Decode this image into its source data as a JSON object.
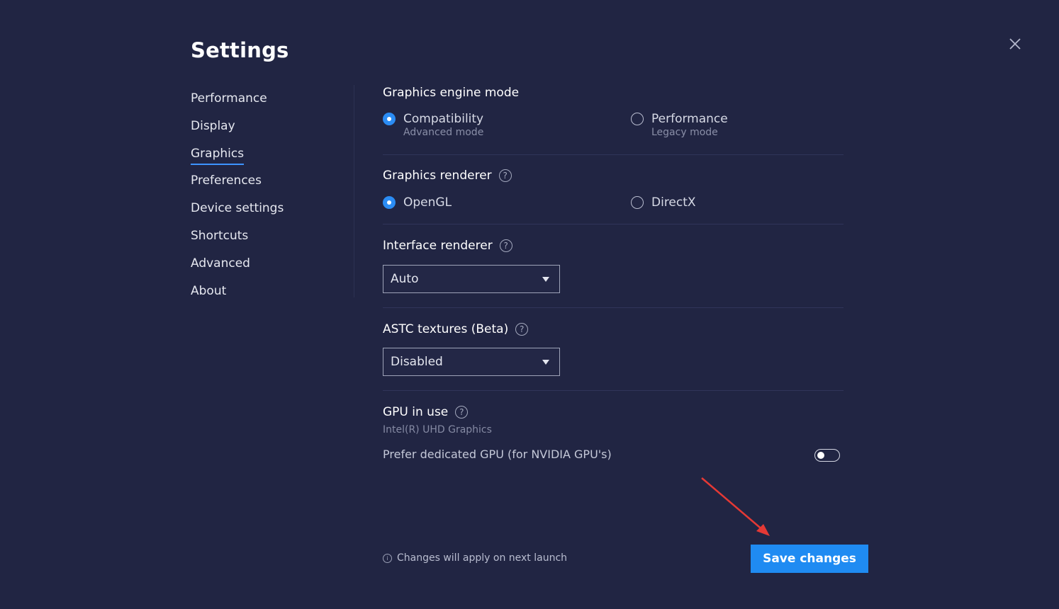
{
  "page_title": "Settings",
  "colors": {
    "background": "#212543",
    "accent": "#1f8bf2",
    "annotation_arrow": "#e53935"
  },
  "sidebar": {
    "items": [
      {
        "label": "Performance"
      },
      {
        "label": "Display"
      },
      {
        "label": "Graphics",
        "active": true
      },
      {
        "label": "Preferences"
      },
      {
        "label": "Device settings"
      },
      {
        "label": "Shortcuts"
      },
      {
        "label": "Advanced"
      },
      {
        "label": "About"
      }
    ]
  },
  "graphics": {
    "engine_mode": {
      "title": "Graphics engine mode",
      "options": [
        {
          "label": "Compatibility",
          "sub": "Advanced mode",
          "selected": true
        },
        {
          "label": "Performance",
          "sub": "Legacy mode",
          "selected": false
        }
      ]
    },
    "renderer": {
      "title": "Graphics renderer",
      "options": [
        {
          "label": "OpenGL",
          "selected": true
        },
        {
          "label": "DirectX",
          "selected": false
        }
      ]
    },
    "interface_renderer": {
      "title": "Interface renderer",
      "value": "Auto"
    },
    "astc": {
      "title": "ASTC textures (Beta)",
      "value": "Disabled"
    },
    "gpu": {
      "title": "GPU in use",
      "value": "Intel(R) UHD Graphics",
      "toggle_label": "Prefer dedicated GPU (for NVIDIA GPU's)",
      "toggle_on": false
    }
  },
  "footer": {
    "note": "Changes will apply on next launch",
    "save_label": "Save changes"
  },
  "icons": {
    "help": "?",
    "info": "i"
  }
}
